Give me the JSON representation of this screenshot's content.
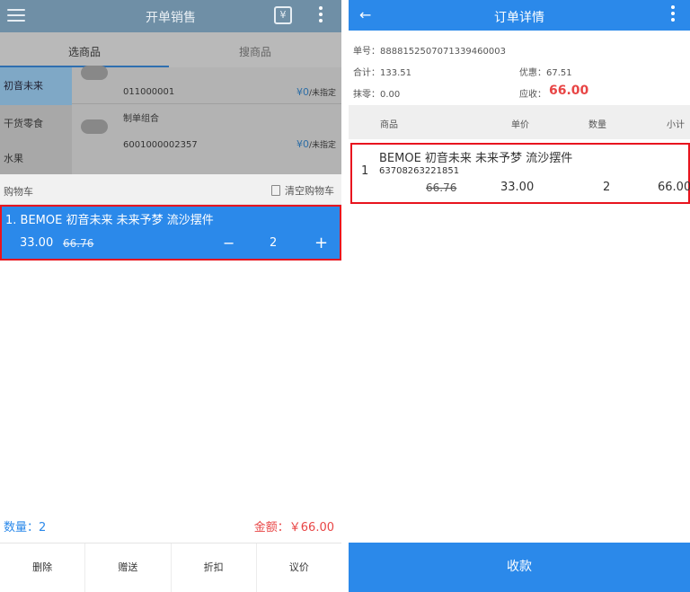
{
  "left": {
    "header": {
      "title": "开单销售",
      "scan_glyph": "¥"
    },
    "tabs": [
      "选商品",
      "搜商品"
    ],
    "categories": [
      "初音未来",
      "干货零食",
      "水果"
    ],
    "products": [
      {
        "code": "011000001",
        "price": "¥0",
        "unit": "/未指定"
      },
      {
        "name": "制单组合",
        "code": "6001000002357",
        "price": "¥0",
        "unit": "/未指定"
      }
    ],
    "cart": {
      "label": "购物车",
      "clear": "清空购物车"
    },
    "cart_item": {
      "name": "1. BEMOE 初音未来 未来予梦 流沙摆件",
      "price": "33.00",
      "original_price": "66.76",
      "minus": "−",
      "qty": "2",
      "plus": "+"
    },
    "summary": {
      "qty": "数量：2",
      "amount": "金额：￥66.00"
    },
    "actions": [
      "删除",
      "赠送",
      "折扣",
      "议价"
    ]
  },
  "right": {
    "header": {
      "back": "←",
      "title": "订单详情"
    },
    "info": {
      "order_no": "单号：8888152507071339460003",
      "total": "合计：133.51",
      "discount": "优惠：67.51",
      "change": "抹零：0.00",
      "receivable_label": "应收：",
      "receivable": "66.00"
    },
    "table": {
      "headers": [
        "商品",
        "单价",
        "数量",
        "小计"
      ]
    },
    "row": {
      "idx": "1",
      "name": "BEMOE 初音未来 未来予梦 流沙摆件",
      "code": "63708263221851",
      "original_price": "66.76",
      "unit_price": "33.00",
      "qty": "2",
      "subtotal": "66.00"
    },
    "pay_button": "收款"
  },
  "colors": {
    "primary": "#2b89ea",
    "highlight_border": "#e8141e",
    "price_red": "#e84545",
    "overlay_header": "#6f8fa6"
  }
}
